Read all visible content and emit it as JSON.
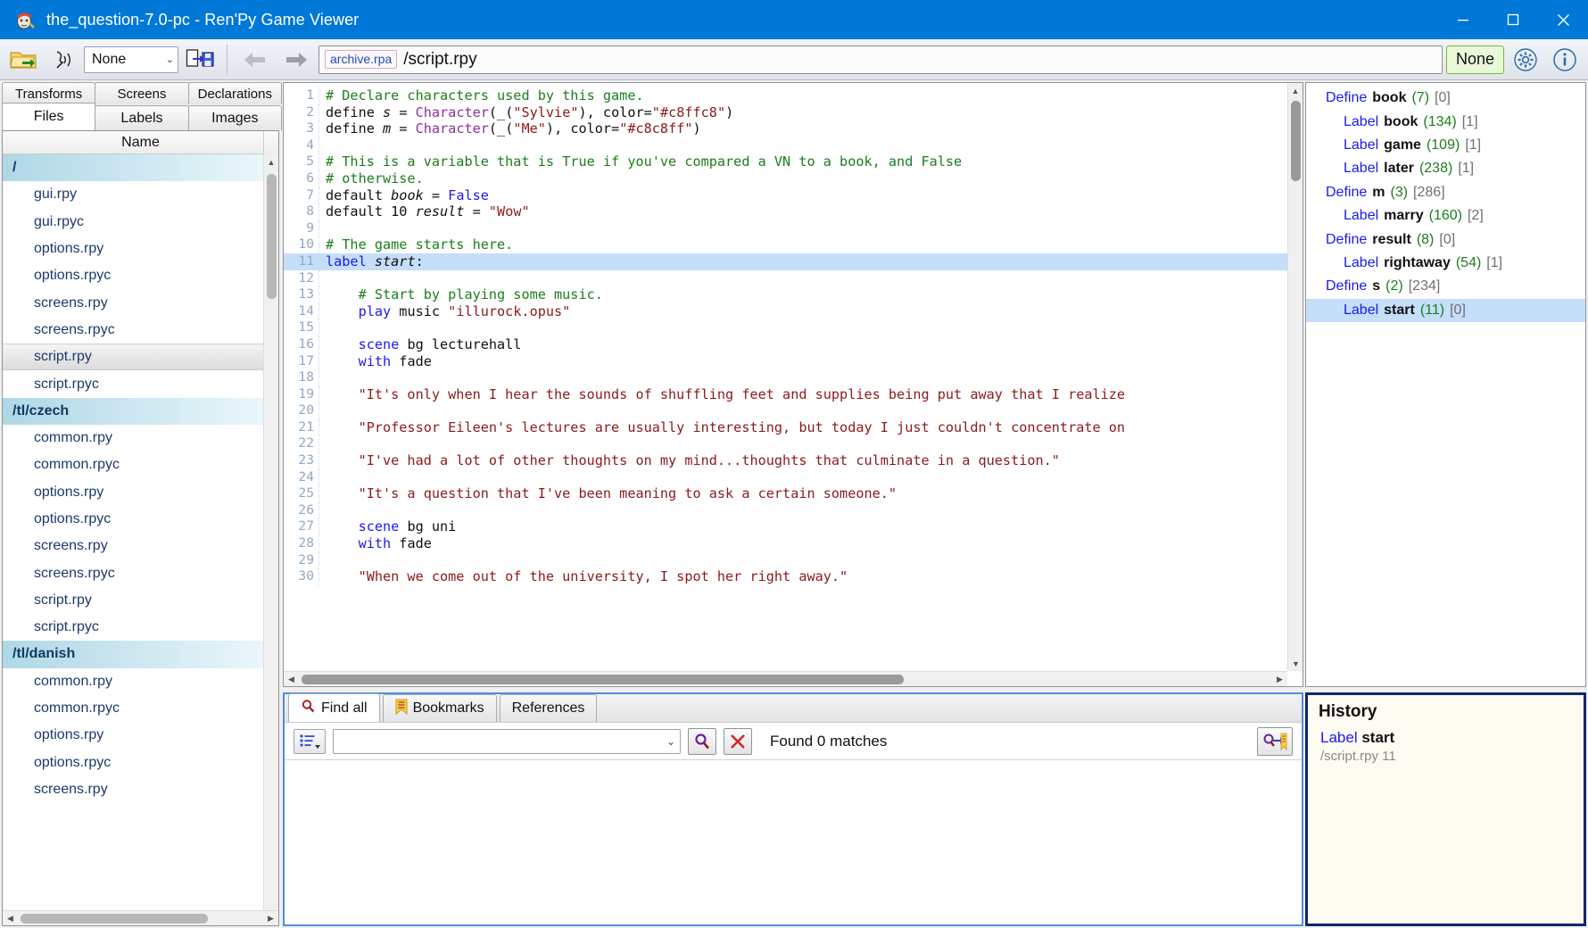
{
  "window": {
    "title": "the_question-7.0-pc - Ren'Py Game Viewer",
    "icon": "renpy-app-icon",
    "minimize": "–",
    "maximize": "☐",
    "close": "✕",
    "accent": "#0078d7"
  },
  "toolbar": {
    "open_icon": "open-folder-icon",
    "voice_icon": "voice-speaker-icon",
    "combo_value": "None",
    "combo_caret": "⌄",
    "export_icon": "export-save-icon",
    "back_icon": "←",
    "forward_icon": "→",
    "archive_badge": "archive.rpa",
    "path": "/script.rpy",
    "none_button": "None",
    "settings_icon": "gear-icon",
    "info_icon": "info-icon"
  },
  "left_panel": {
    "tabs_top": [
      "Transforms",
      "Screens",
      "Declarations"
    ],
    "tabs_bottom": [
      "Files",
      "Labels",
      "Images"
    ],
    "active_tab": "Files",
    "column_header": "Name",
    "rows": [
      {
        "label": "/",
        "type": "root"
      },
      {
        "label": "gui.rpy",
        "type": "file"
      },
      {
        "label": "gui.rpyc",
        "type": "file"
      },
      {
        "label": "options.rpy",
        "type": "file"
      },
      {
        "label": "options.rpyc",
        "type": "file"
      },
      {
        "label": "screens.rpy",
        "type": "file"
      },
      {
        "label": "screens.rpyc",
        "type": "file"
      },
      {
        "label": "script.rpy",
        "type": "selected"
      },
      {
        "label": "script.rpyc",
        "type": "file"
      },
      {
        "label": "/tl/czech",
        "type": "group"
      },
      {
        "label": "common.rpy",
        "type": "file"
      },
      {
        "label": "common.rpyc",
        "type": "file"
      },
      {
        "label": "options.rpy",
        "type": "file"
      },
      {
        "label": "options.rpyc",
        "type": "file"
      },
      {
        "label": "screens.rpy",
        "type": "file"
      },
      {
        "label": "screens.rpyc",
        "type": "file"
      },
      {
        "label": "script.rpy",
        "type": "file"
      },
      {
        "label": "script.rpyc",
        "type": "file"
      },
      {
        "label": "/tl/danish",
        "type": "group"
      },
      {
        "label": "common.rpy",
        "type": "file"
      },
      {
        "label": "common.rpyc",
        "type": "file"
      },
      {
        "label": "options.rpy",
        "type": "file"
      },
      {
        "label": "options.rpyc",
        "type": "file"
      },
      {
        "label": "screens.rpy",
        "type": "file"
      }
    ]
  },
  "editor": {
    "highlighted_line": 11,
    "lines": [
      {
        "n": 1,
        "tokens": [
          {
            "t": "# Declare characters used by this game.",
            "c": "k-com"
          }
        ]
      },
      {
        "n": 2,
        "tokens": [
          {
            "t": "define ",
            "c": "k-pl"
          },
          {
            "t": "s",
            "c": "k-var"
          },
          {
            "t": " = ",
            "c": "k-pl"
          },
          {
            "t": "Character",
            "c": "k-fn"
          },
          {
            "t": "(_(",
            "c": "k-pl"
          },
          {
            "t": "\"Sylvie\"",
            "c": "k-str"
          },
          {
            "t": "), color=",
            "c": "k-pl"
          },
          {
            "t": "\"#c8ffc8\"",
            "c": "k-str"
          },
          {
            "t": ")",
            "c": "k-pl"
          }
        ]
      },
      {
        "n": 3,
        "tokens": [
          {
            "t": "define ",
            "c": "k-pl"
          },
          {
            "t": "m",
            "c": "k-var"
          },
          {
            "t": " = ",
            "c": "k-pl"
          },
          {
            "t": "Character",
            "c": "k-fn"
          },
          {
            "t": "(_(",
            "c": "k-pl"
          },
          {
            "t": "\"Me\"",
            "c": "k-str"
          },
          {
            "t": "), color=",
            "c": "k-pl"
          },
          {
            "t": "\"#c8c8ff\"",
            "c": "k-str"
          },
          {
            "t": ")",
            "c": "k-pl"
          }
        ]
      },
      {
        "n": 4,
        "tokens": []
      },
      {
        "n": 5,
        "tokens": [
          {
            "t": "# This is a variable that is True if you've compared a VN to a book, and False",
            "c": "k-com"
          }
        ]
      },
      {
        "n": 6,
        "tokens": [
          {
            "t": "# otherwise.",
            "c": "k-com"
          }
        ]
      },
      {
        "n": 7,
        "tokens": [
          {
            "t": "default ",
            "c": "k-pl"
          },
          {
            "t": "book",
            "c": "k-var"
          },
          {
            "t": " = ",
            "c": "k-pl"
          },
          {
            "t": "False",
            "c": "k-kw"
          }
        ]
      },
      {
        "n": 8,
        "tokens": [
          {
            "t": "default 10 ",
            "c": "k-pl"
          },
          {
            "t": "result",
            "c": "k-var"
          },
          {
            "t": " = ",
            "c": "k-pl"
          },
          {
            "t": "\"Wow\"",
            "c": "k-str"
          }
        ]
      },
      {
        "n": 9,
        "tokens": []
      },
      {
        "n": 10,
        "tokens": [
          {
            "t": "# The game starts here.",
            "c": "k-com"
          }
        ]
      },
      {
        "n": 11,
        "tokens": [
          {
            "t": "label ",
            "c": "k-kw"
          },
          {
            "t": "start",
            "c": "k-var"
          },
          {
            "t": ":",
            "c": "k-pl"
          }
        ]
      },
      {
        "n": 12,
        "tokens": []
      },
      {
        "n": 13,
        "tokens": [
          {
            "t": "    # Start by playing some music.",
            "c": "k-com"
          }
        ]
      },
      {
        "n": 14,
        "tokens": [
          {
            "t": "    ",
            "c": "k-pl"
          },
          {
            "t": "play",
            "c": "k-kw"
          },
          {
            "t": " music ",
            "c": "k-pl"
          },
          {
            "t": "\"illurock.opus\"",
            "c": "k-str"
          }
        ]
      },
      {
        "n": 15,
        "tokens": []
      },
      {
        "n": 16,
        "tokens": [
          {
            "t": "    ",
            "c": "k-pl"
          },
          {
            "t": "scene",
            "c": "k-kw"
          },
          {
            "t": " bg lecturehall",
            "c": "k-pl"
          }
        ]
      },
      {
        "n": 17,
        "tokens": [
          {
            "t": "    ",
            "c": "k-pl"
          },
          {
            "t": "with",
            "c": "k-kw"
          },
          {
            "t": " fade",
            "c": "k-pl"
          }
        ]
      },
      {
        "n": 18,
        "tokens": []
      },
      {
        "n": 19,
        "tokens": [
          {
            "t": "    \"It's only when I hear the sounds of shuffling feet and supplies being put away that I realize",
            "c": "k-str"
          }
        ]
      },
      {
        "n": 20,
        "tokens": []
      },
      {
        "n": 21,
        "tokens": [
          {
            "t": "    \"Professor Eileen's lectures are usually interesting, but today I just couldn't concentrate on",
            "c": "k-str"
          }
        ]
      },
      {
        "n": 22,
        "tokens": []
      },
      {
        "n": 23,
        "tokens": [
          {
            "t": "    \"I've had a lot of other thoughts on my mind...thoughts that culminate in a question.\"",
            "c": "k-str"
          }
        ]
      },
      {
        "n": 24,
        "tokens": []
      },
      {
        "n": 25,
        "tokens": [
          {
            "t": "    \"It's a question that I've been meaning to ask a certain someone.\"",
            "c": "k-str"
          }
        ]
      },
      {
        "n": 26,
        "tokens": []
      },
      {
        "n": 27,
        "tokens": [
          {
            "t": "    ",
            "c": "k-pl"
          },
          {
            "t": "scene",
            "c": "k-kw"
          },
          {
            "t": " bg uni",
            "c": "k-pl"
          }
        ]
      },
      {
        "n": 28,
        "tokens": [
          {
            "t": "    ",
            "c": "k-pl"
          },
          {
            "t": "with",
            "c": "k-kw"
          },
          {
            "t": " fade",
            "c": "k-pl"
          }
        ]
      },
      {
        "n": 29,
        "tokens": []
      },
      {
        "n": 30,
        "tokens": [
          {
            "t": "    \"When we come out of the university, I spot her right away.\"",
            "c": "k-str"
          }
        ]
      }
    ]
  },
  "find_panel": {
    "tabs": [
      {
        "label": "Find all",
        "icon": "magnifier-icon",
        "active": true
      },
      {
        "label": "Bookmarks",
        "icon": "bookmark-icon",
        "active": false
      },
      {
        "label": "References",
        "icon": "",
        "active": false
      }
    ],
    "options_icon": "list-options-icon",
    "search_value": "",
    "search_caret": "⌄",
    "search_icon": "search-icon",
    "clear_icon": "clear-x-icon",
    "status": "Found 0 matches",
    "goto_icon": "find-bookmark-icon"
  },
  "symbols": [
    {
      "kind": "Define",
      "name": "book",
      "count": "(7)",
      "refs": "[0]",
      "indent": false,
      "selected": false
    },
    {
      "kind": "Label",
      "name": "book",
      "count": "(134)",
      "refs": "[1]",
      "indent": true,
      "selected": false
    },
    {
      "kind": "Label",
      "name": "game",
      "count": "(109)",
      "refs": "[1]",
      "indent": true,
      "selected": false
    },
    {
      "kind": "Label",
      "name": "later",
      "count": "(238)",
      "refs": "[1]",
      "indent": true,
      "selected": false
    },
    {
      "kind": "Define",
      "name": "m",
      "count": "(3)",
      "refs": "[286]",
      "indent": false,
      "selected": false
    },
    {
      "kind": "Label",
      "name": "marry",
      "count": "(160)",
      "refs": "[2]",
      "indent": true,
      "selected": false
    },
    {
      "kind": "Define",
      "name": "result",
      "count": "(8)",
      "refs": "[0]",
      "indent": false,
      "selected": false
    },
    {
      "kind": "Label",
      "name": "rightaway",
      "count": "(54)",
      "refs": "[1]",
      "indent": true,
      "selected": false
    },
    {
      "kind": "Define",
      "name": "s",
      "count": "(2)",
      "refs": "[234]",
      "indent": false,
      "selected": false
    },
    {
      "kind": "Label",
      "name": "start",
      "count": "(11)",
      "refs": "[0]",
      "indent": true,
      "selected": true
    }
  ],
  "history": {
    "title": "History",
    "items": [
      {
        "kind": "Label",
        "name": "start",
        "location": "/script.rpy 11"
      }
    ]
  }
}
